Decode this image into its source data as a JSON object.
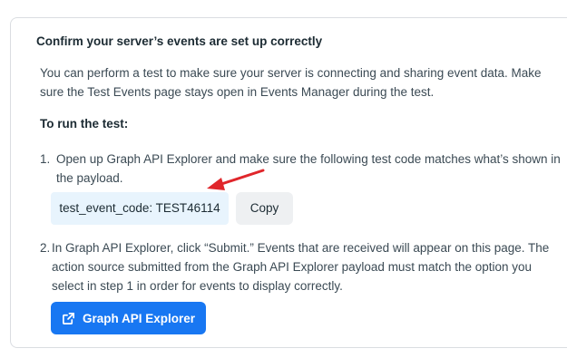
{
  "card": {
    "title": "Confirm your server’s events are set up correctly",
    "intro": "You can perform a test to make sure your server is connecting and sharing event data. Make sure the Test Events page stays open in Events Manager during the test.",
    "run_heading": "To run the test:"
  },
  "steps": [
    {
      "number": "1.",
      "text": "Open up Graph API Explorer and make sure the following test code matches what’s shown in the payload."
    },
    {
      "number": "2.",
      "text": "In Graph API Explorer, click “Submit.” Events that are received will appear on this page. The action source submitted from the Graph API Explorer payload must match the option you select in step 1 in order for events to display correctly."
    }
  ],
  "test_code": {
    "value": "test_event_code: TEST46114",
    "copy_label": "Copy"
  },
  "explorer_button": {
    "label": "Graph API Explorer",
    "icon": "external-link-icon"
  },
  "colors": {
    "accent": "#1877f2",
    "annotation_arrow": "#e0262b",
    "code_bg": "#e8f4fd"
  }
}
